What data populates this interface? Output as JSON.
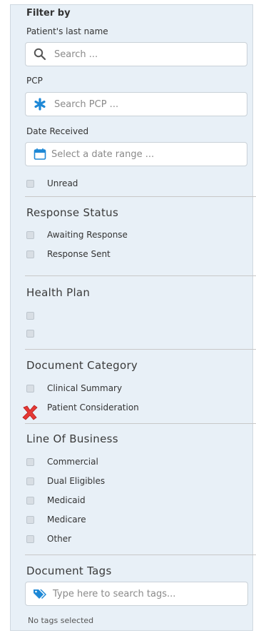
{
  "filter_by": "Filter by",
  "last_name": {
    "label": "Patient's last name",
    "placeholder": "Search ..."
  },
  "pcp": {
    "label": "PCP",
    "placeholder": "Search PCP ..."
  },
  "date_received": {
    "label": "Date Received",
    "placeholder": "Select a date range ..."
  },
  "unread_label": "Unread",
  "response_status": {
    "title": "Response Status",
    "options": [
      "Awaiting Response",
      "Response Sent"
    ]
  },
  "health_plan": {
    "title": "Health Plan",
    "options": [
      "",
      ""
    ]
  },
  "document_category": {
    "title": "Document Category",
    "options": [
      "Clinical Summary",
      "Patient Consideration"
    ]
  },
  "line_of_business": {
    "title": "Line Of Business",
    "options": [
      "Commercial",
      "Dual Eligibles",
      "Medicaid",
      "Medicare",
      "Other"
    ]
  },
  "document_tags": {
    "title": "Document Tags",
    "placeholder": "Type here to search tags...",
    "status": "No tags selected"
  },
  "colors": {
    "panel_bg": "#e8f0f7",
    "accent_blue": "#1e88d6",
    "x_red": "#e53935"
  }
}
